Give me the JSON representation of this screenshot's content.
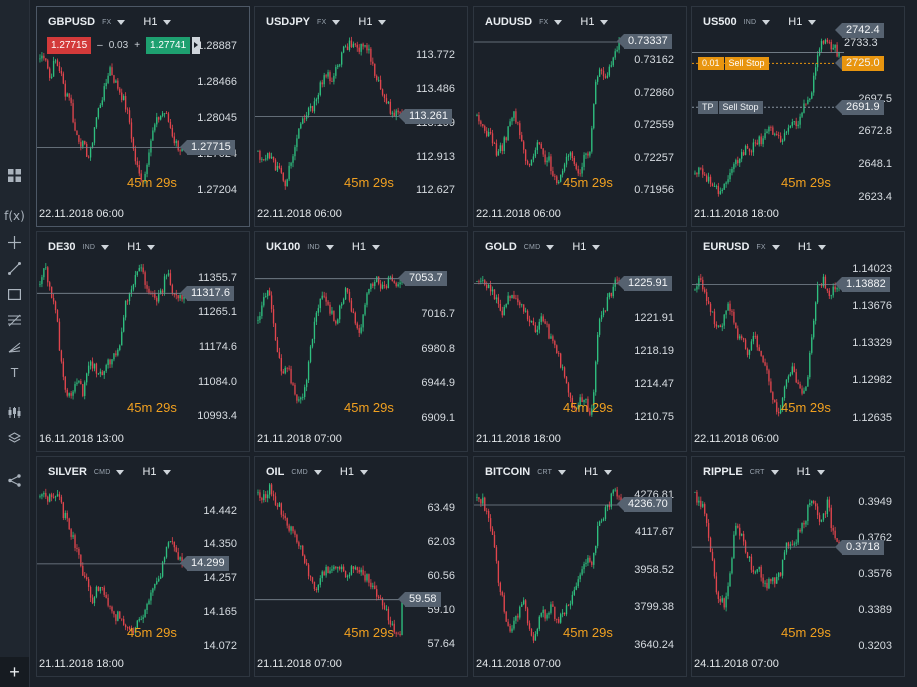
{
  "app": {
    "timer_main": "45m",
    "timer_sec": "29s",
    "colors": {
      "bg": "#1b2129",
      "up": "#2fbf7f",
      "down": "#e0454d",
      "accent": "#f0a020",
      "tag": "#566270",
      "order": "#e8950f"
    }
  },
  "sidebar": {
    "icons": [
      "grid-icon",
      "function-icon",
      "crosshair-icon",
      "trendline-icon",
      "rectangle-icon",
      "fibonacci-icon",
      "pitchfork-icon",
      "text-icon",
      "indicators-icon",
      "layers-icon",
      "share-icon"
    ],
    "fx_label": "f(x)",
    "text_label": "T",
    "add_label": "+"
  },
  "panels": [
    {
      "symbol": "GBPUSD",
      "class": "FX",
      "timeframe": "H1",
      "date": "22.11.2018 06:00",
      "ticks": [
        "1.28887",
        "1.28466",
        "1.28045",
        "1.27624",
        "1.27204"
      ],
      "price": "1.27715",
      "trade": {
        "sell": "1.27715",
        "qty": "0.03",
        "buy": "1.27741",
        "minus": "–",
        "plus": "+"
      },
      "chart_data": {
        "type": "candlestick",
        "ylim": [
          1.27045,
          1.29045
        ],
        "last": 1.27715,
        "path": [
          1.2875,
          1.2881,
          1.2851,
          1.2873,
          1.2862,
          1.2836,
          1.2832,
          1.2791,
          1.278,
          1.277,
          1.2758,
          1.2797,
          1.2821,
          1.2838,
          1.2866,
          1.2849,
          1.2838,
          1.2824,
          1.2802,
          1.2761,
          1.2739,
          1.2735,
          1.2773,
          1.2795,
          1.2807,
          1.2813,
          1.28,
          1.278,
          1.2771,
          1.2765
        ]
      }
    },
    {
      "symbol": "USDJPY",
      "class": "FX",
      "timeframe": "H1",
      "date": "22.11.2018 06:00",
      "ticks": [
        "113.772",
        "113.486",
        "113.199",
        "112.913",
        "112.627"
      ],
      "price": "113.261",
      "chart_data": {
        "type": "candlestick",
        "ylim": [
          112.51,
          113.97
        ],
        "last": 113.261,
        "path": [
          112.95,
          112.9,
          112.93,
          112.86,
          112.8,
          112.68,
          112.85,
          113.0,
          113.18,
          113.28,
          113.32,
          113.45,
          113.55,
          113.6,
          113.59,
          113.68,
          113.82,
          113.86,
          113.88,
          113.84,
          113.87,
          113.79,
          113.63,
          113.5,
          113.39,
          113.31,
          113.27,
          113.26
        ]
      }
    },
    {
      "symbol": "AUDUSD",
      "class": "FX",
      "timeframe": "H1",
      "date": "22.11.2018 06:00",
      "ticks": [
        "0.73162",
        "0.72860",
        "0.72559",
        "0.72257",
        "0.71956"
      ],
      "price": "0.73337",
      "chart_data": {
        "type": "candlestick",
        "ylim": [
          0.7183,
          0.7342
        ],
        "last": 0.73337,
        "path": [
          0.7262,
          0.7256,
          0.725,
          0.7245,
          0.7228,
          0.7238,
          0.7252,
          0.727,
          0.7254,
          0.7235,
          0.7215,
          0.723,
          0.724,
          0.7228,
          0.7224,
          0.721,
          0.7205,
          0.722,
          0.7228,
          0.7223,
          0.7212,
          0.7228,
          0.7233,
          0.73,
          0.7312,
          0.7302,
          0.731,
          0.7325,
          0.7334
        ]
      }
    },
    {
      "symbol": "US500",
      "class": "IND",
      "timeframe": "H1",
      "date": "21.11.2018 18:00",
      "ticks": [
        "2697.5",
        "2672.8",
        "2648.1",
        "2623.4"
      ],
      "price": "2691.9",
      "top_price": "2742.4",
      "mid_price": "2733.3",
      "orders": [
        {
          "qty": "0.01",
          "name": "Sell Stop",
          "price": "2725.0"
        },
        {
          "qty": "TP",
          "name": "Sell Stop",
          "price": "2691.9"
        }
      ],
      "chart_data": {
        "type": "candlestick",
        "ylim": [
          2618,
          2748
        ],
        "last": 2733.3,
        "path": [
          2645,
          2644,
          2641,
          2636,
          2630,
          2628,
          2632,
          2640,
          2650,
          2655,
          2662,
          2660,
          2665,
          2668,
          2672,
          2675,
          2670,
          2668,
          2675,
          2677,
          2682,
          2690,
          2695,
          2710,
          2738,
          2742,
          2740,
          2736,
          2733
        ]
      }
    },
    {
      "symbol": "DE30",
      "class": "IND",
      "timeframe": "H1",
      "date": "16.11.2018 13:00",
      "ticks": [
        "11355.7",
        "11265.1",
        "11174.6",
        "11084.0",
        "10993.4"
      ],
      "price": "11317.6",
      "chart_data": {
        "type": "candlestick",
        "ylim": [
          10960,
          11410
        ],
        "last": 11317.6,
        "path": [
          11345,
          11380,
          11320,
          11270,
          11130,
          11060,
          11035,
          11100,
          11060,
          11140,
          11130,
          11110,
          11120,
          11140,
          11150,
          11175,
          11290,
          11330,
          11360,
          11395,
          11320,
          11330,
          11300,
          11330,
          11385,
          11305,
          11310,
          11315
        ]
      }
    },
    {
      "symbol": "UK100",
      "class": "IND",
      "timeframe": "H1",
      "date": "21.11.2018 07:00",
      "ticks": [
        "7016.7",
        "6980.8",
        "6944.9",
        "6909.1"
      ],
      "price": "7053.7",
      "chart_data": {
        "type": "candlestick",
        "ylim": [
          6898,
          7075
        ],
        "last": 7053.7,
        "path": [
          7010,
          7040,
          7035,
          6985,
          6955,
          6960,
          6940,
          6925,
          6950,
          6990,
          7025,
          7040,
          7020,
          7010,
          7030,
          7045,
          7010,
          7000,
          7035,
          7050,
          7055,
          7040,
          7060,
          7050,
          7055
        ]
      }
    },
    {
      "symbol": "GOLD",
      "class": "CMD",
      "timeframe": "H1",
      "date": "21.11.2018 18:00",
      "ticks": [
        "1221.91",
        "1218.19",
        "1214.47",
        "1210.75"
      ],
      "price": "1225.91",
      "chart_data": {
        "type": "candlestick",
        "ylim": [
          1209.4,
          1228.8
        ],
        "last": 1225.91,
        "path": [
          1225.8,
          1226.6,
          1225.3,
          1224.5,
          1222.6,
          1223.4,
          1224.8,
          1223.8,
          1222.9,
          1221.6,
          1220.6,
          1221.9,
          1221.1,
          1219.3,
          1217.9,
          1215.6,
          1213.0,
          1212.1,
          1212.8,
          1212.4,
          1211.2,
          1220.8,
          1222.9,
          1224.4,
          1225.9,
          1226.3
        ]
      }
    },
    {
      "symbol": "EURUSD",
      "class": "FX",
      "timeframe": "H1",
      "date": "22.11.2018 06:00",
      "ticks": [
        "1.14023",
        "1.13676",
        "1.13329",
        "1.12982",
        "1.12635"
      ],
      "price": "1.13882",
      "chart_data": {
        "type": "candlestick",
        "ylim": [
          1.1253,
          1.1413
        ],
        "last": 1.13882,
        "path": [
          1.1388,
          1.1395,
          1.1378,
          1.1365,
          1.1345,
          1.135,
          1.1372,
          1.1362,
          1.134,
          1.1335,
          1.1323,
          1.134,
          1.133,
          1.1318,
          1.1292,
          1.1275,
          1.127,
          1.1298,
          1.131,
          1.13,
          1.129,
          1.1295,
          1.1345,
          1.1385,
          1.1392,
          1.1378,
          1.1385,
          1.1388
        ]
      }
    },
    {
      "symbol": "SILVER",
      "class": "CMD",
      "timeframe": "H1",
      "date": "21.11.2018 18:00",
      "ticks": [
        "14.442",
        "14.350",
        "14.257",
        "14.165",
        "14.072"
      ],
      "price": "14.299",
      "chart_data": {
        "type": "candlestick",
        "ylim": [
          14.05,
          14.52
        ],
        "last": 14.299,
        "path": [
          14.49,
          14.48,
          14.48,
          14.49,
          14.44,
          14.4,
          14.36,
          14.3,
          14.25,
          14.2,
          14.24,
          14.22,
          14.18,
          14.15,
          14.16,
          14.13,
          14.12,
          14.14,
          14.17,
          14.2,
          14.24,
          14.28,
          14.34,
          14.36,
          14.31,
          14.3
        ]
      }
    },
    {
      "symbol": "OIL",
      "class": "CMD",
      "timeframe": "H1",
      "date": "21.11.2018 07:00",
      "ticks": [
        "63.49",
        "62.03",
        "60.56",
        "59.10",
        "57.64"
      ],
      "price": "59.58",
      "chart_data": {
        "type": "candlestick",
        "ylim": [
          57.2,
          64.6
        ],
        "last": 59.58,
        "path": [
          64.2,
          64.0,
          64.4,
          63.8,
          63.4,
          62.9,
          62.4,
          62.0,
          61.4,
          60.5,
          59.9,
          60.6,
          60.9,
          60.8,
          61.0,
          60.6,
          60.9,
          61.0,
          60.8,
          60.5,
          60.1,
          59.7,
          59.2,
          58.6,
          58.2,
          58.0
        ]
      }
    },
    {
      "symbol": "BITCOIN",
      "class": "CRT",
      "timeframe": "H1",
      "date": "24.11.2018 07:00",
      "ticks": [
        "4276.81",
        "4117.67",
        "3958.52",
        "3799.38",
        "3640.24"
      ],
      "price": "4236.70",
      "chart_data": {
        "type": "candlestick",
        "ylim": [
          3600,
          4330
        ],
        "last": 4236.7,
        "path": [
          4260,
          4250,
          4200,
          4050,
          3880,
          3760,
          3700,
          3760,
          3850,
          3720,
          3650,
          3800,
          3760,
          3820,
          3720,
          3790,
          3800,
          3900,
          3960,
          4010,
          3980,
          4150,
          4200,
          4250,
          4320,
          4240
        ]
      }
    },
    {
      "symbol": "RIPPLE",
      "class": "CRT",
      "timeframe": "H1",
      "date": "24.11.2018 07:00",
      "ticks": [
        "0.3949",
        "0.3762",
        "0.3576",
        "0.3389",
        "0.3203"
      ],
      "price": "0.3718",
      "chart_data": {
        "type": "candlestick",
        "ylim": [
          0.316,
          0.405
        ],
        "last": 0.3718,
        "path": [
          0.398,
          0.395,
          0.385,
          0.366,
          0.345,
          0.342,
          0.356,
          0.385,
          0.379,
          0.369,
          0.359,
          0.364,
          0.35,
          0.356,
          0.354,
          0.36,
          0.376,
          0.37,
          0.38,
          0.384,
          0.396,
          0.39,
          0.385,
          0.395,
          0.378,
          0.3718
        ]
      }
    }
  ]
}
